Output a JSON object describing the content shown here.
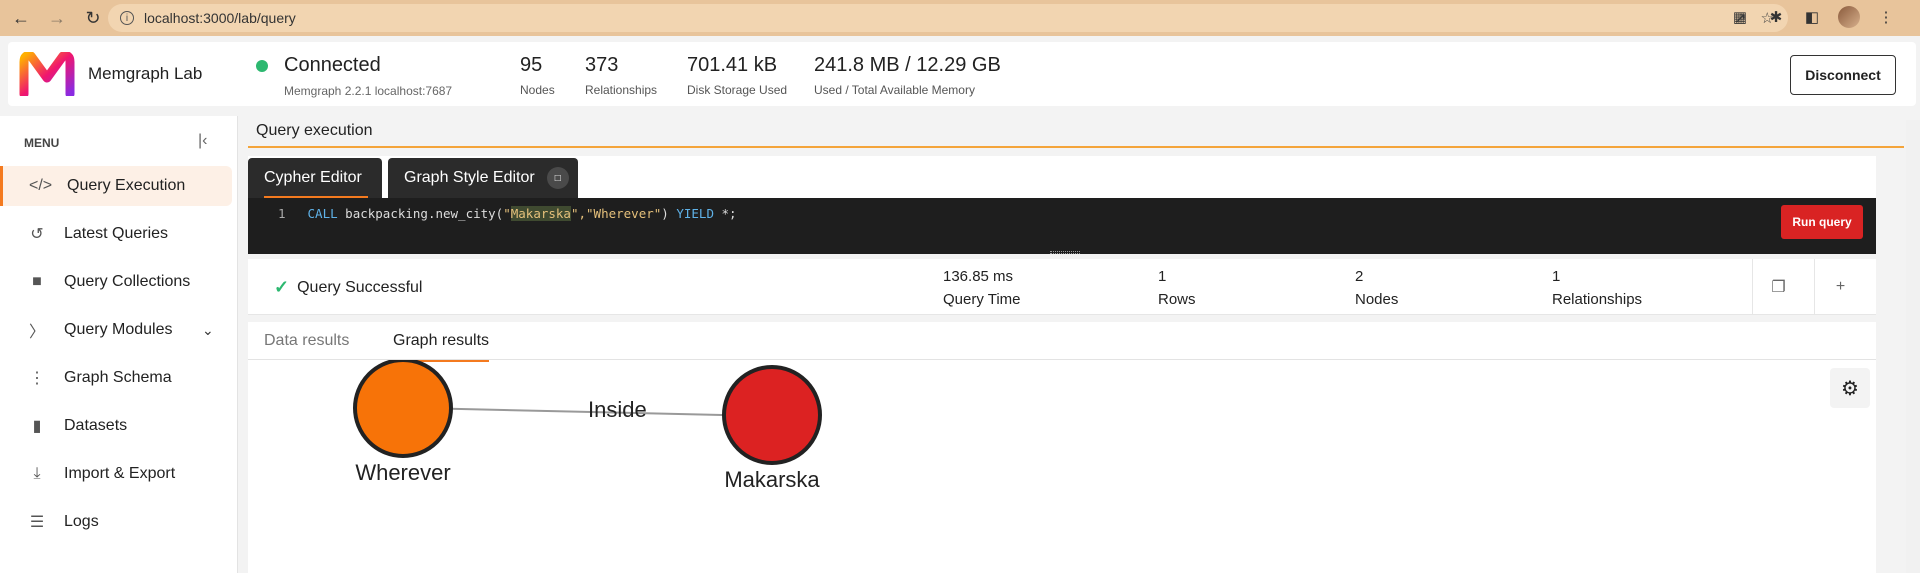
{
  "browser": {
    "url": "localhost:3000/lab/query"
  },
  "header": {
    "brand": "Memgraph Lab",
    "status_title": "Connected",
    "status_sub": "Memgraph 2.2.1  localhost:7687",
    "stats": [
      {
        "value": "95",
        "label": "Nodes"
      },
      {
        "value": "373",
        "label": "Relationships"
      },
      {
        "value": "701.41 kB",
        "label": "Disk Storage Used"
      },
      {
        "value": "241.8 MB / 12.29 GB",
        "label": "Used / Total Available Memory"
      }
    ],
    "disconnect_label": "Disconnect"
  },
  "sidebar": {
    "menu_title": "MENU",
    "items": [
      {
        "label": "Query Execution",
        "icon": "code-icon"
      },
      {
        "label": "Latest Queries",
        "icon": "history-icon"
      },
      {
        "label": "Query Collections",
        "icon": "folder-icon"
      },
      {
        "label": "Query Modules",
        "icon": "terminal-icon"
      },
      {
        "label": "Graph Schema",
        "icon": "schema-icon"
      },
      {
        "label": "Datasets",
        "icon": "book-icon"
      },
      {
        "label": "Import & Export",
        "icon": "download-icon"
      },
      {
        "label": "Logs",
        "icon": "list-icon"
      }
    ]
  },
  "main": {
    "title": "Query execution",
    "tabs": [
      "Cypher Editor",
      "Graph Style Editor"
    ],
    "code": {
      "line_no": "1",
      "kw_call": "CALL",
      "fn": " backpacking.new_city(",
      "q1": "\"",
      "arg1": "Makarska",
      "q2": "\",\"",
      "arg2": "Wherever",
      "q3": "\"",
      "close": ") ",
      "kw_yield": "YIELD",
      "rest": " *;"
    },
    "run_label": "Run query",
    "result": {
      "status": "Query Successful",
      "stats": [
        {
          "value": "136.85 ms",
          "label": "Query Time"
        },
        {
          "value": "1",
          "label": "Rows"
        },
        {
          "value": "2",
          "label": "Nodes"
        },
        {
          "value": "1",
          "label": "Relationships"
        }
      ]
    },
    "result_tabs": [
      "Data results",
      "Graph results"
    ],
    "graph": {
      "nodes": [
        {
          "label": "Wherever",
          "color": "#f77308"
        },
        {
          "label": "Makarska",
          "color": "#dc2222"
        }
      ],
      "edge_label": "Inside"
    }
  },
  "colors": {
    "accent": "#f47a1f",
    "connected": "#2db870",
    "run": "#d92323"
  }
}
